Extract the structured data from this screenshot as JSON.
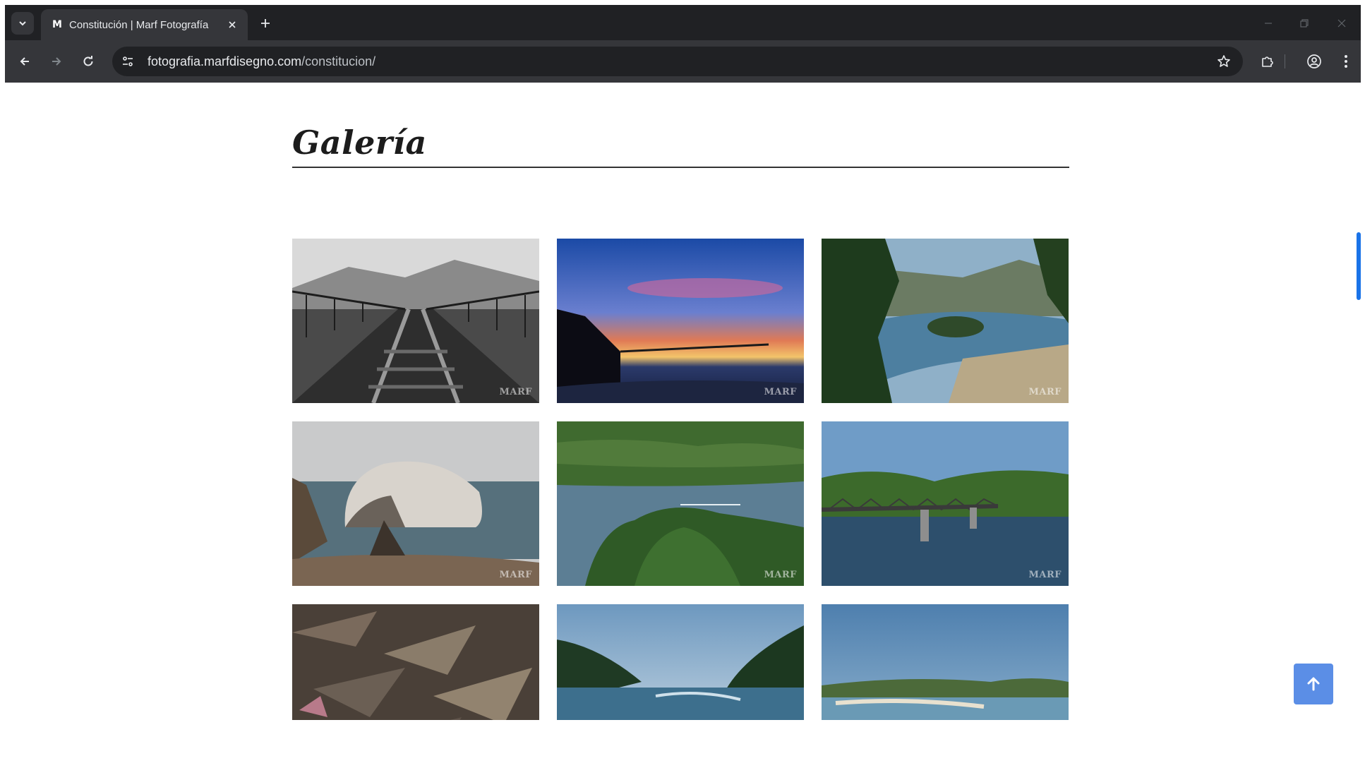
{
  "browser": {
    "tab_title": "Constitución | Marf Fotografía",
    "favicon_letter": "M",
    "url_domain": "fotografia.marfdisegno.com",
    "url_path": "/constitucion/"
  },
  "page": {
    "heading": "Galería",
    "watermark": "MARF",
    "accent_color": "#5b8ee6",
    "gallery": [
      {
        "name": "railway-bridge-bw"
      },
      {
        "name": "sunset-pier"
      },
      {
        "name": "river-view-trees"
      },
      {
        "name": "sea-rock"
      },
      {
        "name": "river-forest"
      },
      {
        "name": "railway-bridge-river"
      },
      {
        "name": "dry-leaves"
      },
      {
        "name": "river-valley"
      },
      {
        "name": "river-mouth-panorama"
      }
    ]
  },
  "icons": {
    "tab_search": "chevron-down-icon",
    "close": "close-icon",
    "new_tab": "plus-icon",
    "back": "arrow-left-icon",
    "forward": "arrow-right-icon",
    "reload": "reload-icon",
    "site_info": "tune-icon",
    "bookmark": "star-icon",
    "extensions": "puzzle-icon",
    "profile": "account-icon",
    "menu": "kebab-menu-icon",
    "scroll_top": "arrow-up-icon"
  }
}
